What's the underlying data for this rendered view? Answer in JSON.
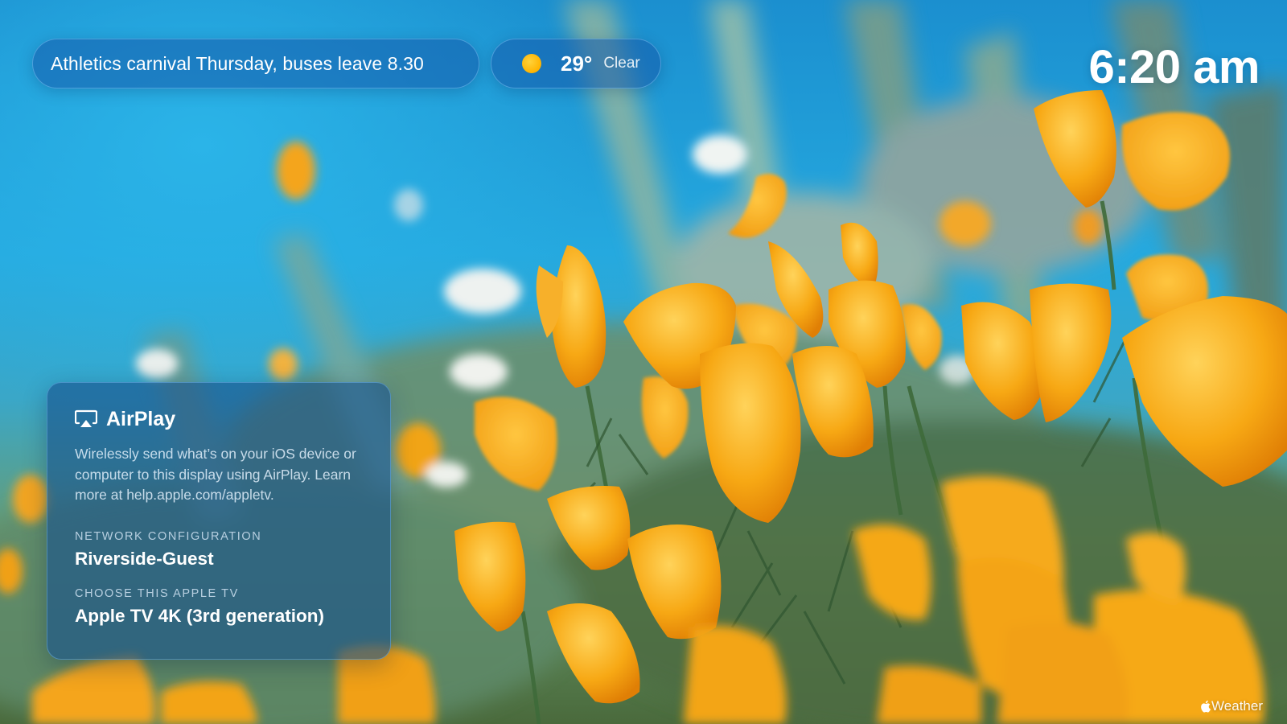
{
  "announcement": {
    "text": "Athletics carnival Thursday, buses leave 8.30"
  },
  "weather": {
    "icon": "sun-icon",
    "temperature": "29°",
    "condition": "Clear"
  },
  "clock": {
    "time": "6:20 am"
  },
  "airplay_card": {
    "icon": "airplay-icon",
    "title": "AirPlay",
    "description": "Wirelessly send what’s on your iOS device or computer to this display using AirPlay. Learn more at help.apple.com/appletv.",
    "network_label": "NETWORK CONFIGURATION",
    "network_value": "Riverside-Guest",
    "device_label": "CHOOSE THIS APPLE TV",
    "device_value": "Apple TV 4K (3rd generation)"
  },
  "footer": {
    "icon": "apple-logo-icon",
    "credit": "Weather"
  },
  "colors": {
    "sky": "#1ea0d8",
    "flower": "#f7a814",
    "panel": "#16508c",
    "sun": "#ffb300"
  }
}
